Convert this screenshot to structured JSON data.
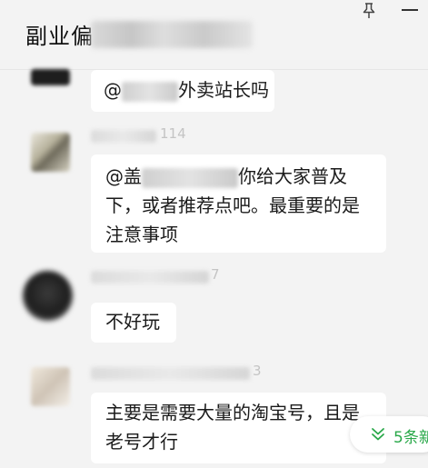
{
  "header": {
    "title": "副业偏"
  },
  "icons": {
    "pin": "pin-icon",
    "minimize": "minimize-icon",
    "new_messages_arrow": "double-chevron-down-icon"
  },
  "messages": [
    {
      "text_prefix": "@",
      "text_suffix": "外卖站长吗"
    },
    {
      "name_tail": "114",
      "text_prefix": "@盖",
      "text_line1_suffix": "你给大家普及",
      "text_line2": "下，或者推荐点吧。最重要的是",
      "text_line3": "注意事项"
    },
    {
      "name_tail": "7",
      "text": "不好玩"
    },
    {
      "name_tail": "3",
      "text_line1": "主要是需要大量的淘宝号，且是",
      "text_line2": "老号才行"
    }
  ],
  "new_messages": {
    "label": "5条新"
  },
  "colors": {
    "background": "#f3f3f3",
    "bubble": "#ffffff",
    "accent_green": "#2aa84a"
  }
}
